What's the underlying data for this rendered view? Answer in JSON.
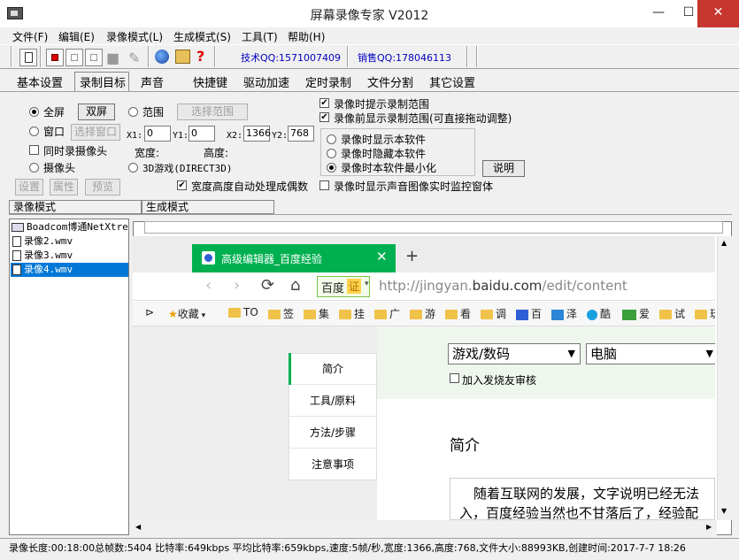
{
  "window": {
    "title": "屏幕录像专家 V2012",
    "minimize": "—",
    "maximize": "☐",
    "close": "✕"
  },
  "menu": [
    "文件(F)",
    "编辑(E)",
    "录像模式(L)",
    "生成模式(S)",
    "工具(T)",
    "帮助(H)"
  ],
  "toolbar": {
    "qq_tech": "技术QQ:1571007409",
    "qq_sales": "销售QQ:178046113"
  },
  "tabs": [
    "基本设置",
    "录制目标",
    "声音",
    "快捷键",
    "驱动加速",
    "定时录制",
    "文件分割",
    "其它设置"
  ],
  "active_tab": "录制目标",
  "target": {
    "fullscreen": "全屏",
    "dual_screen": "双屏",
    "range": "范围",
    "select_range": "选择范围",
    "window": "窗口",
    "select_window": "选择窗口",
    "x1_label": "X1:",
    "x1": "0",
    "y1_label": "Y1:",
    "y1": "0",
    "x2_label": "X2:",
    "x2": "1366",
    "y2_label": "Y2:",
    "y2": "768",
    "also_camera": "同时录摄像头",
    "width": "宽度:",
    "height": "高度:",
    "camera": "摄像头",
    "game3d": "3D游戏(DIRECT3D)",
    "settings": "设置",
    "properties": "属性",
    "preview": "预览",
    "even_dims": "宽度高度自动处理成偶数",
    "hint_range": "录像时提示录制范围",
    "show_range": "录像前显示录制范围(可直接拖动调整)",
    "show_self": "录像时显示本软件",
    "hide_self": "录像时隐藏本软件",
    "minimize_self": "录像时本软件最小化",
    "explain": "说明",
    "audio_monitor": "录像时显示声音图像实时监控窗体"
  },
  "sections": {
    "record_mode": "录像模式",
    "generate_mode": "生成模式"
  },
  "files": [
    "Boadcom博通NetXtrem",
    "录像2.wmv",
    "录像3.wmv",
    "录像4.wmv"
  ],
  "browser": {
    "tab_title": "高级编辑器_百度经验",
    "tab_close": "✕",
    "new_tab": "+",
    "baidu": "百度",
    "zheng": "证",
    "url_pre": "http://jingyan.",
    "url_host": "baidu.com",
    "url_post": "/edit/content",
    "bookmarks": [
      "收藏",
      "TO",
      "签",
      "集",
      "挂",
      "广",
      "游",
      "看",
      "调",
      "百",
      "泽",
      "酷",
      "爱",
      "试",
      "玩"
    ],
    "side_nav": [
      "简介",
      "工具/原料",
      "方法/步骤",
      "注意事项"
    ],
    "category": "游戏/数码",
    "subcategory": "电脑",
    "review_check": "加入发烧友审核",
    "intro_title": "简介",
    "editor_line1": "随着互联网的发展，文字说明已经无法",
    "editor_line2": "入，百度经验当然也不甘落后了，经验配"
  },
  "status": "录像长度:00:18:00总帧数:5404 比特率:649kbps 平均比特率:659kbps,速度:5帧/秒,宽度:1366,高度:768,文件大小:88993KB,创建时间:2017-7-7 18:26"
}
